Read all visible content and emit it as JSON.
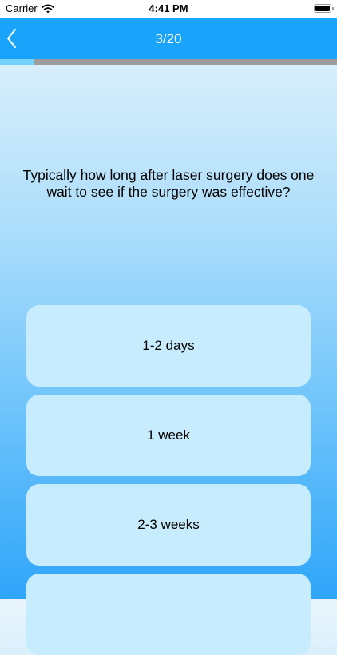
{
  "status_bar": {
    "carrier": "Carrier",
    "time": "4:41 PM",
    "wifi_icon": "wifi-icon",
    "battery_icon": "battery-icon"
  },
  "nav": {
    "title": "3/20",
    "back_icon": "chevron-left-icon",
    "color": "#1aa3fb"
  },
  "progress": {
    "current": 3,
    "total": 20,
    "fraction": 0.1
  },
  "question": {
    "text": "Typically how long after laser surgery does one wait to see if the surgery was effective?"
  },
  "answers": [
    {
      "label": "1-2 days"
    },
    {
      "label": "1 week"
    },
    {
      "label": "2-3 weeks"
    },
    {
      "label": ""
    }
  ]
}
